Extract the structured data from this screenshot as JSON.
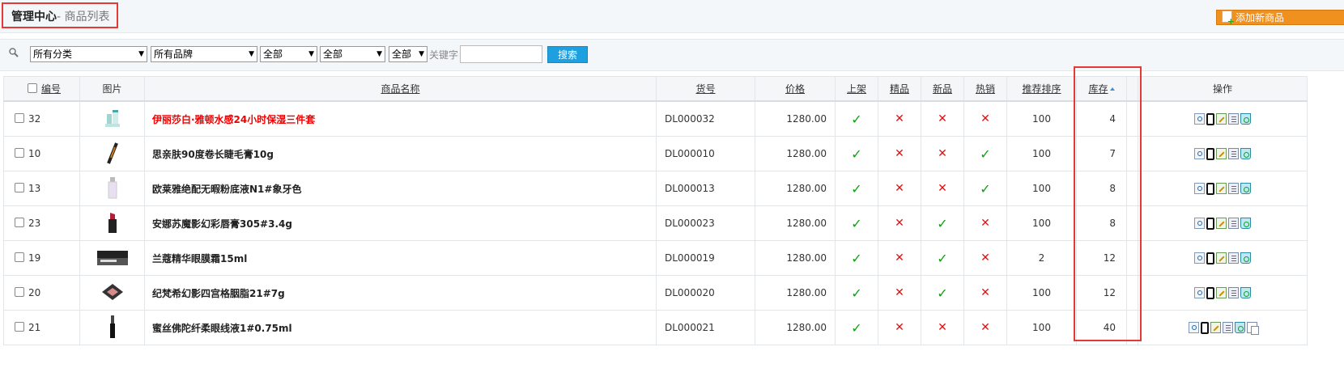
{
  "header": {
    "title_main": "管理中心",
    "title_sub": "- 商品列表",
    "add_button": "添加新商品"
  },
  "search": {
    "category": "所有分类",
    "brand": "所有品牌",
    "filter1": "全部",
    "filter2": "全部",
    "filter3": "全部",
    "keyword_label": "关键字",
    "keyword_value": "",
    "button": "搜索"
  },
  "table": {
    "headers": {
      "id": "编号",
      "image": "图片",
      "name": "商品名称",
      "sn": "货号",
      "price": "价格",
      "on_sale": "上架",
      "best": "精品",
      "new": "新品",
      "hot": "热销",
      "sort_order": "推荐排序",
      "stock": "库存",
      "ops": "操作"
    },
    "rows": [
      {
        "id": "32",
        "name": "伊丽莎白·雅顿水感24小时保湿三件套",
        "sn": "DL000032",
        "price": "1280.00",
        "on_sale": true,
        "best": false,
        "new": false,
        "hot": false,
        "sort_order": "100",
        "stock": "4",
        "image": "lotion-bottles",
        "name_color": "#f00000"
      },
      {
        "id": "10",
        "name": "思亲肤90度卷长睫毛膏10g",
        "sn": "DL000010",
        "price": "1280.00",
        "on_sale": true,
        "best": false,
        "new": false,
        "hot": true,
        "sort_order": "100",
        "stock": "7",
        "image": "mascara"
      },
      {
        "id": "13",
        "name": "欧莱雅绝配无暇粉底液N1#象牙色",
        "sn": "DL000013",
        "price": "1280.00",
        "on_sale": true,
        "best": false,
        "new": false,
        "hot": true,
        "sort_order": "100",
        "stock": "8",
        "image": "foundation-bottle"
      },
      {
        "id": "23",
        "name": "安娜苏魔影幻彩唇膏305#3.4g",
        "sn": "DL000023",
        "price": "1280.00",
        "on_sale": true,
        "best": false,
        "new": true,
        "hot": false,
        "sort_order": "100",
        "stock": "8",
        "image": "lipstick"
      },
      {
        "id": "19",
        "name": "兰蔻精华眼膜霜15ml",
        "sn": "DL000019",
        "price": "1280.00",
        "on_sale": true,
        "best": false,
        "new": true,
        "hot": false,
        "sort_order": "2",
        "stock": "12",
        "image": "eye-cream-jar"
      },
      {
        "id": "20",
        "name": "纪梵希幻影四宫格胭脂21#7g",
        "sn": "DL000020",
        "price": "1280.00",
        "on_sale": true,
        "best": false,
        "new": true,
        "hot": false,
        "sort_order": "100",
        "stock": "12",
        "image": "blush-compact"
      },
      {
        "id": "21",
        "name": "蜜丝佛陀纤柔眼线液1#0.75ml",
        "sn": "DL000021",
        "price": "1280.00",
        "on_sale": true,
        "best": false,
        "new": false,
        "hot": false,
        "sort_order": "100",
        "stock": "40",
        "image": "eyeliner"
      }
    ]
  },
  "colors": {
    "check": "#11a011",
    "cross": "#dd1111",
    "highlight": "#e53935",
    "search_button": "#1e9fe0",
    "add_button": "#f0901e"
  }
}
